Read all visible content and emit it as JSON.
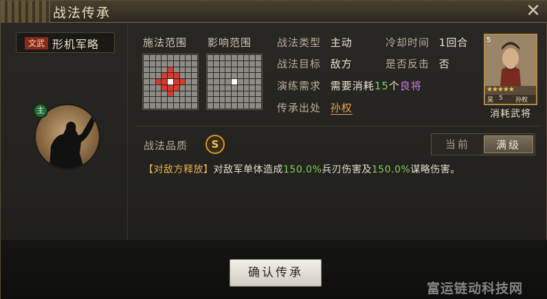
{
  "window": {
    "title": "战法传承",
    "close_icon": "close-icon"
  },
  "skill": {
    "tag": "文武",
    "name": "形机军略",
    "main_badge": "主"
  },
  "range": {
    "cast_label": "施法范围",
    "effect_label": "影响范围"
  },
  "info": {
    "type_label": "战法类型",
    "type_value": "主动",
    "cooldown_label": "冷却时间",
    "cooldown_value": "1回合",
    "target_label": "战法目标",
    "target_value": "敌方",
    "counter_label": "是否反击",
    "counter_value": "否",
    "train_label": "演练需求",
    "train_prefix": "需要消耗",
    "train_count": "15",
    "train_unit": "个",
    "train_rarity": "良将",
    "origin_label": "传承出处",
    "origin_value": "孙权"
  },
  "general_card": {
    "cost": "5",
    "stars": "★★★★★",
    "faction": "吴",
    "level": "5",
    "name": "孙权",
    "caption": "消耗武将"
  },
  "quality": {
    "label": "战法品质",
    "grade": "S"
  },
  "toggle": {
    "current": "当前",
    "max": "满级"
  },
  "description": {
    "tag": "【对敌方释放】",
    "text_1": "对敌军单体造成",
    "num_1": "150.0%",
    "text_2": "兵刃伤害及",
    "num_2": "150.0%",
    "text_3": "谋略伤害。"
  },
  "confirm_label": "确认传承",
  "watermark": "富运链动科技网",
  "colors": {
    "accent_gold": "#d29a32",
    "green": "#7fd25a",
    "purple": "#c67ee6",
    "red_cell": "#d23b30"
  }
}
